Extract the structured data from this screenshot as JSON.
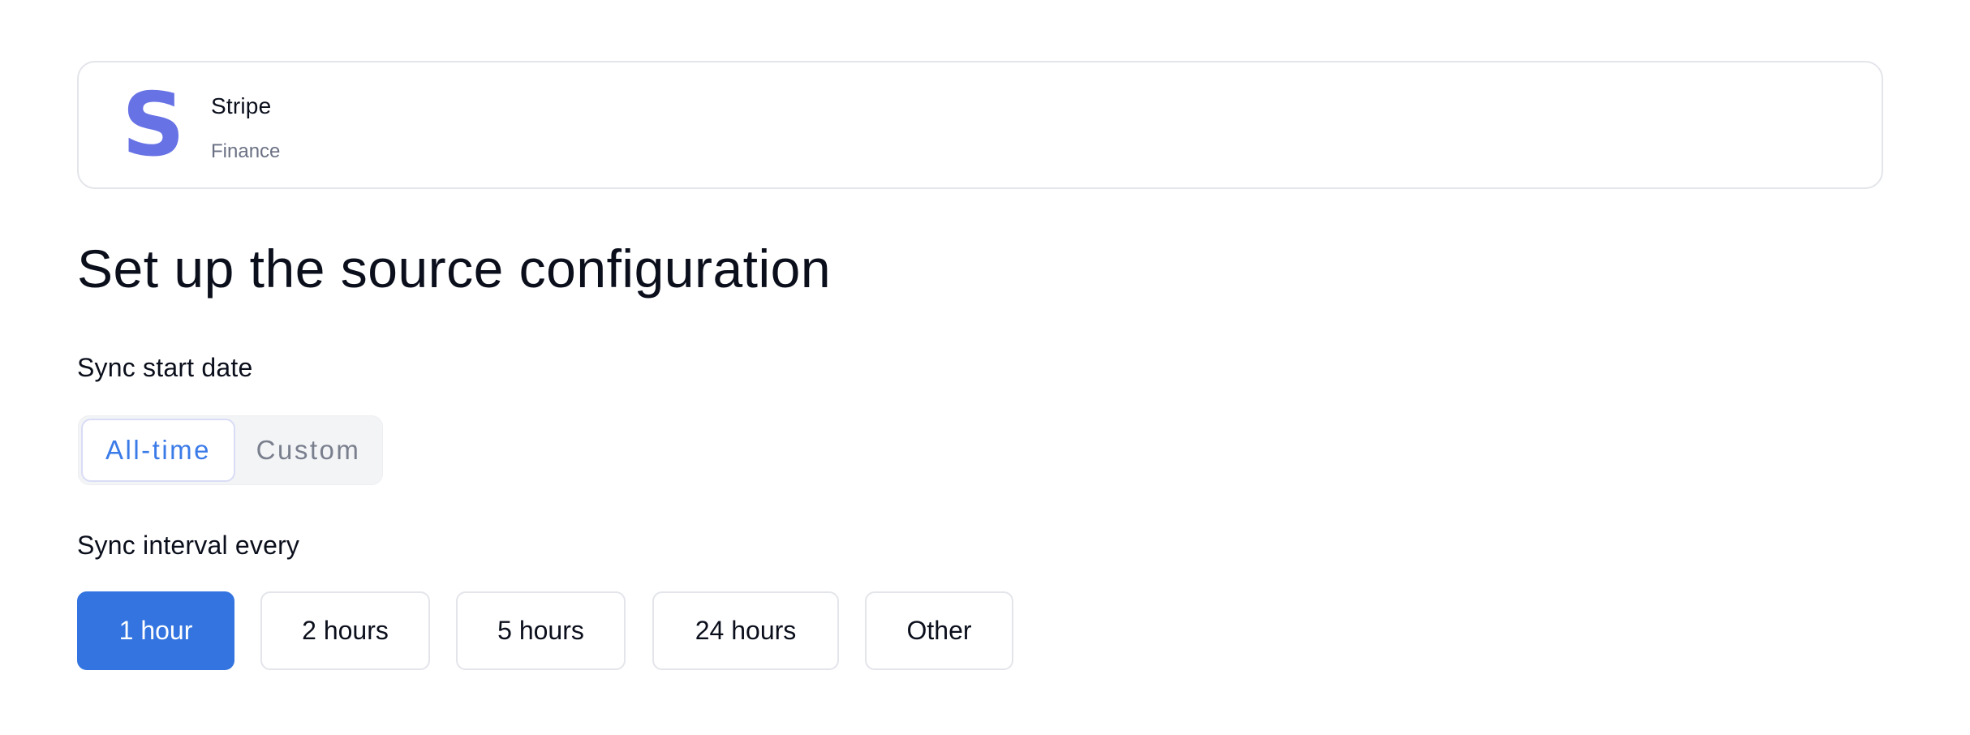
{
  "source": {
    "name": "Stripe",
    "category": "Finance",
    "logo_icon": "stripe-logo-icon",
    "logo_color": "#6772e5"
  },
  "page_title": "Set up the source configuration",
  "sync_start": {
    "label": "Sync start date",
    "options": [
      "All-time",
      "Custom"
    ],
    "selected": "All-time"
  },
  "sync_interval": {
    "label": "Sync interval every",
    "options": [
      "1 hour",
      "2 hours",
      "5 hours",
      "24 hours",
      "Other"
    ],
    "selected": "1 hour"
  },
  "colors": {
    "accent": "#3374e0",
    "segment_active_text": "#3b7be8",
    "muted_text": "#7a7f8e",
    "border": "#e3e5ea"
  }
}
